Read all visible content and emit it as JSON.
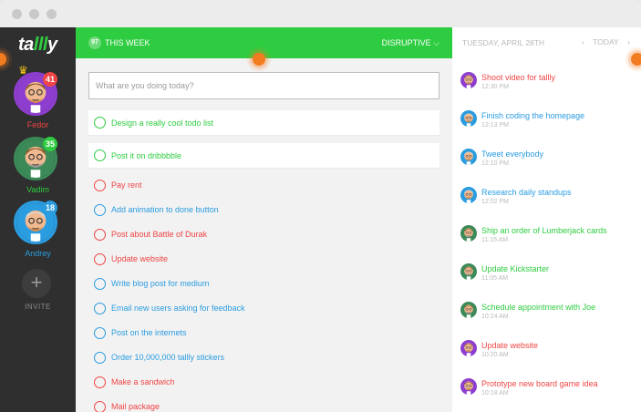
{
  "app": {
    "brand_left": "ta",
    "brand_mid": "lll",
    "brand_right": "y"
  },
  "colors": {
    "accent": "#2ecc40",
    "red": "#ef4545",
    "blue": "#2a9ce0",
    "purple": "#a23dc4",
    "green_dark": "#3c8f55",
    "sidebar": "#2f2f2f"
  },
  "users": [
    {
      "name": "Fedor",
      "badge": "41",
      "color": "#ef4545",
      "ring": "#8e3ecf",
      "crown": true
    },
    {
      "name": "Vadim",
      "badge": "35",
      "color": "#2ecc40",
      "ring": "#3b8a57",
      "crown": false
    },
    {
      "name": "Andrey",
      "badge": "18",
      "color": "#2a9ce0",
      "ring": "#2a9ce0",
      "crown": false
    }
  ],
  "invite": {
    "icon": "plus-icon",
    "label": "INVITE"
  },
  "header": {
    "count": "97",
    "title": "THIS WEEK",
    "filter": "DISRUPTIVE",
    "filter_icon": "chevron-down-icon"
  },
  "new_task": {
    "placeholder": "What are you doing today?"
  },
  "tasks": [
    {
      "label": "Design a really cool todo list",
      "color": "#2ecc40",
      "card": true
    },
    {
      "label": "Post it on dribbbble",
      "color": "#2ecc40",
      "card": true
    },
    {
      "label": "Pay rent",
      "color": "#ef4545",
      "card": false
    },
    {
      "label": "Add animation to done button",
      "color": "#2a9ce0",
      "card": false
    },
    {
      "label": "Post about Battle of Durak",
      "color": "#ef4545",
      "card": false
    },
    {
      "label": "Update website",
      "color": "#ef4545",
      "card": false
    },
    {
      "label": "Write blog post for medium",
      "color": "#2a9ce0",
      "card": false
    },
    {
      "label": "Email new users asking for feedback",
      "color": "#2a9ce0",
      "card": false
    },
    {
      "label": "Post on the internets",
      "color": "#2a9ce0",
      "card": false
    },
    {
      "label": "Order 10,000,000 tallly stickers",
      "color": "#2a9ce0",
      "card": false
    },
    {
      "label": "Make a sandwich",
      "color": "#ef4545",
      "card": false
    },
    {
      "label": "Mail package",
      "color": "#ef4545",
      "card": false
    }
  ],
  "feed": {
    "date": "TUESDAY, APRIL 28TH",
    "prev_icon": "chevron-left-icon",
    "today": "TODAY",
    "next_icon": "chevron-right-icon",
    "items": [
      {
        "title": "Shoot video for tallly",
        "time": "12:30 PM",
        "color": "#ef4545",
        "user": "Fedor"
      },
      {
        "title": "Finish coding the homepage",
        "time": "12:13 PM",
        "color": "#2a9ce0",
        "user": "Andrey"
      },
      {
        "title": "Tweet everybody",
        "time": "12:10 PM",
        "color": "#2a9ce0",
        "user": "Andrey"
      },
      {
        "title": "Research daily standups",
        "time": "12:02 PM",
        "color": "#2a9ce0",
        "user": "Andrey"
      },
      {
        "title": "Ship an order of Lumberjack cards",
        "time": "11:15 AM",
        "color": "#2ecc40",
        "user": "Vadim"
      },
      {
        "title": "Update Kickstarter",
        "time": "11:05 AM",
        "color": "#2ecc40",
        "user": "Vadim"
      },
      {
        "title": "Schedule appointment with Joe",
        "time": "10:24 AM",
        "color": "#2ecc40",
        "user": "Vadim"
      },
      {
        "title": "Update website",
        "time": "10:20 AM",
        "color": "#ef4545",
        "user": "Fedor"
      },
      {
        "title": "Prototype new board game idea",
        "time": "10:18 AM",
        "color": "#ef4545",
        "user": "Fedor"
      }
    ]
  }
}
